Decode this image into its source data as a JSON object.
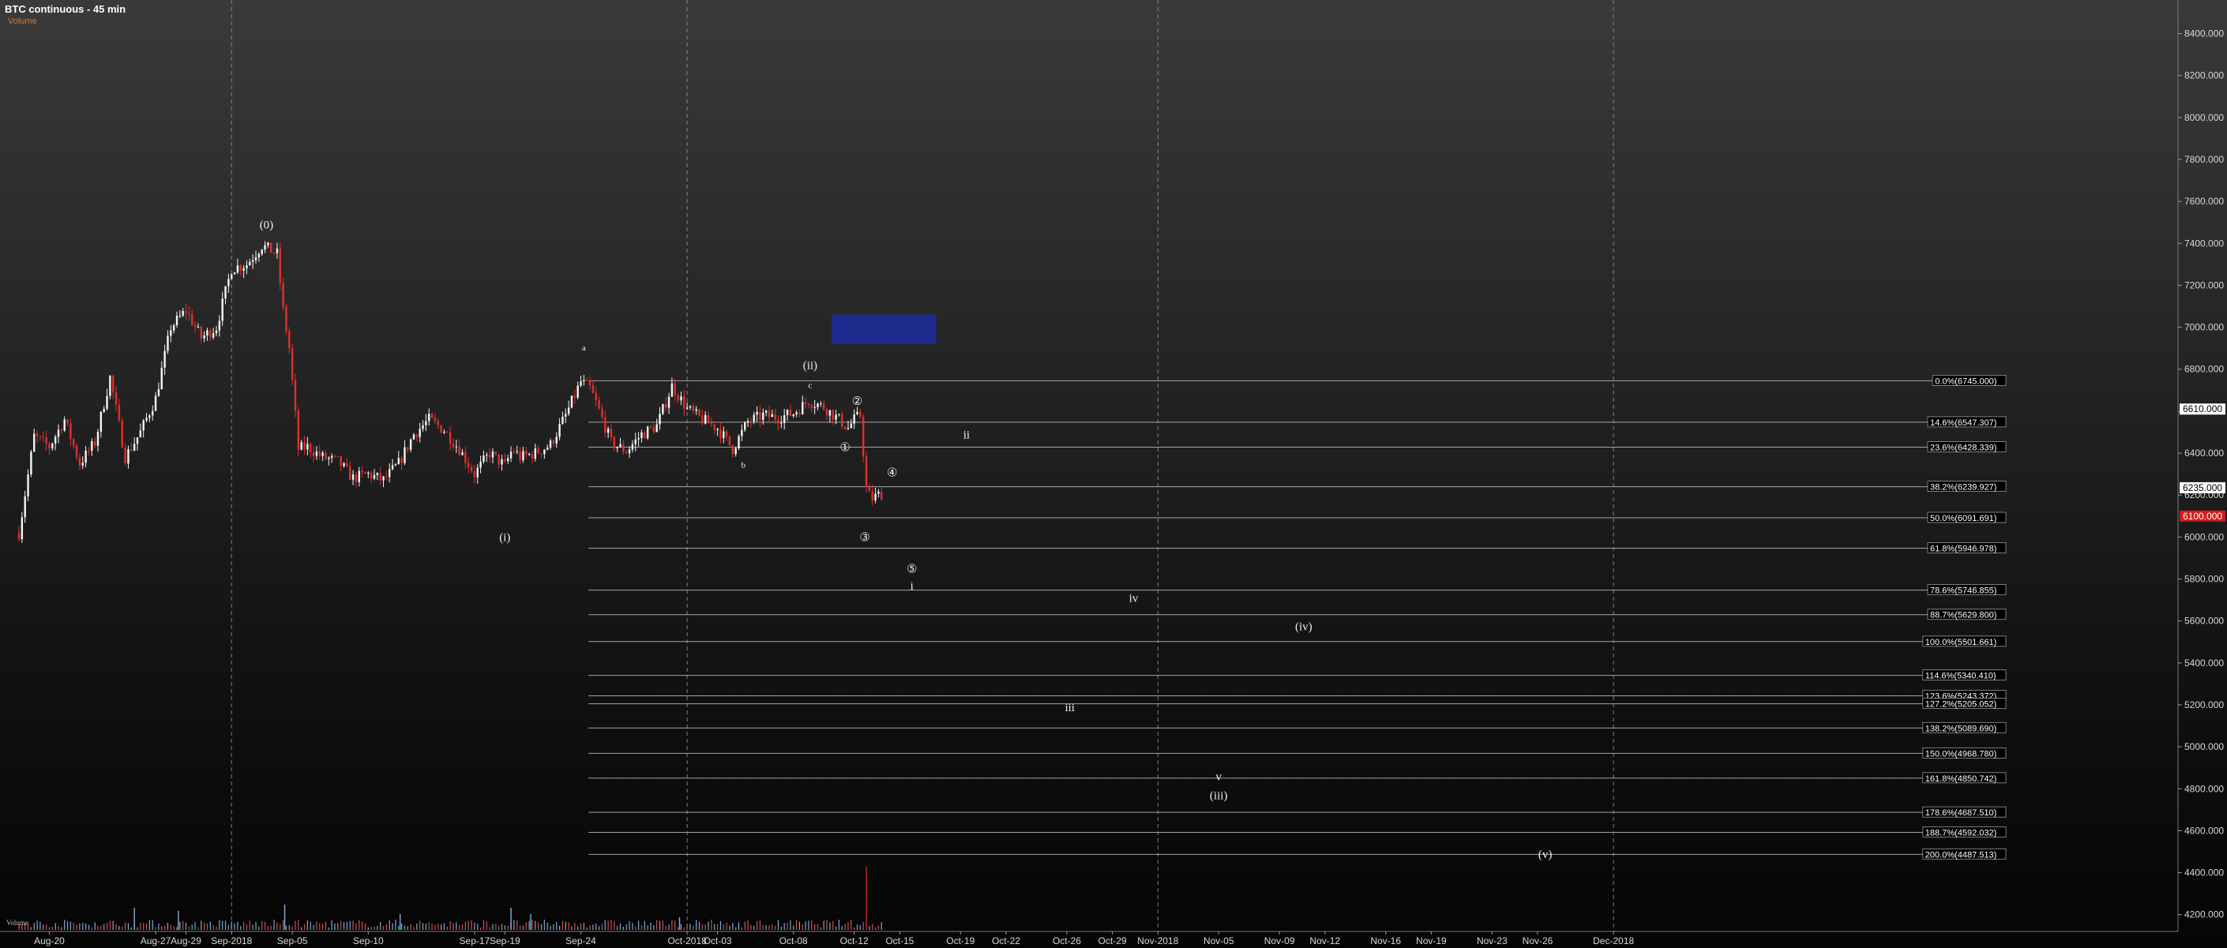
{
  "header": {
    "title": "BTC continuous - 45 min",
    "indicator": "Volume"
  },
  "colors": {
    "up_candle": "#f5f5f5",
    "down_candle": "#e03030",
    "fib_line": "#bdbdbd",
    "box_fill": "#1e2a8c",
    "last_price_marker": "#ffffff",
    "red_price_marker": "#d01c1c"
  },
  "chart_data": {
    "type": "candlestick",
    "title": "BTC continuous - 45 min",
    "y_ticks": [
      "8400.000",
      "8200.000",
      "8000.000",
      "7800.000",
      "7600.000",
      "7400.000",
      "7200.000",
      "7000.000",
      "6800.000",
      "6600.000",
      "6400.000",
      "6200.000",
      "6000.000",
      "5800.000",
      "5600.000",
      "5400.000",
      "5200.000",
      "5000.000",
      "4800.000",
      "4600.000",
      "4400.000",
      "4200.000"
    ],
    "ylim": [
      4120,
      8560
    ],
    "price_markers": [
      {
        "label": "6610.000",
        "value": 6610,
        "style": "white"
      },
      {
        "label": "6235.000",
        "value": 6235,
        "style": "white"
      },
      {
        "label": "6100.000",
        "value": 6100,
        "style": "red"
      }
    ],
    "x_ticks": [
      {
        "label": "Aug-20",
        "day": 2
      },
      {
        "label": "Aug-27",
        "day": 9
      },
      {
        "label": "Aug-29",
        "day": 11
      },
      {
        "label": "Sep-2018",
        "day": 14
      },
      {
        "label": "Sep-05",
        "day": 18
      },
      {
        "label": "Sep-10",
        "day": 23
      },
      {
        "label": "Sep-17",
        "day": 30
      },
      {
        "label": "Sep-19",
        "day": 32
      },
      {
        "label": "Sep-24",
        "day": 37
      },
      {
        "label": "Oct-2018",
        "day": 44
      },
      {
        "label": "Oct-03",
        "day": 46
      },
      {
        "label": "Oct-08",
        "day": 51
      },
      {
        "label": "Oct-12",
        "day": 55
      },
      {
        "label": "Oct-15",
        "day": 58
      },
      {
        "label": "Oct-19",
        "day": 62
      },
      {
        "label": "Oct-22",
        "day": 65
      },
      {
        "label": "Oct-26",
        "day": 69
      },
      {
        "label": "Oct-29",
        "day": 72
      },
      {
        "label": "Nov-2018",
        "day": 75
      },
      {
        "label": "Nov-05",
        "day": 79
      },
      {
        "label": "Nov-09",
        "day": 83
      },
      {
        "label": "Nov-12",
        "day": 86
      },
      {
        "label": "Nov-16",
        "day": 90
      },
      {
        "label": "Nov-19",
        "day": 93
      },
      {
        "label": "Nov-23",
        "day": 97
      },
      {
        "label": "Nov-26",
        "day": 100
      },
      {
        "label": "Dec-2018",
        "day": 105
      }
    ],
    "month_separators": [
      14,
      44,
      75,
      105
    ],
    "fib_levels": [
      {
        "label": "0.0%(6745.000)",
        "value": 6745.0
      },
      {
        "label": "14.6%(6547.307)",
        "value": 6547.307
      },
      {
        "label": "23.6%(6428.339)",
        "value": 6428.339
      },
      {
        "label": "38.2%(6239.927)",
        "value": 6239.927
      },
      {
        "label": "50.0%(6091.691)",
        "value": 6091.691
      },
      {
        "label": "61.8%(5946.978)",
        "value": 5946.978
      },
      {
        "label": "78.6%(5746.855)",
        "value": 5746.855
      },
      {
        "label": "88.7%(5629.800)",
        "value": 5629.8
      },
      {
        "label": "100.0%(5501.661)",
        "value": 5501.661
      },
      {
        "label": "114.6%(5340.410)",
        "value": 5340.41
      },
      {
        "label": "123.6%(5243.372)",
        "value": 5243.372
      },
      {
        "label": "127.2%(5205.052)",
        "value": 5205.052
      },
      {
        "label": "138.2%(5089.690)",
        "value": 5089.69
      },
      {
        "label": "150.0%(4968.780)",
        "value": 4968.78
      },
      {
        "label": "161.8%(4850.742)",
        "value": 4850.742
      },
      {
        "label": "178.6%(4687.510)",
        "value": 4687.51
      },
      {
        "label": "188.7%(4592.032)",
        "value": 4592.032
      },
      {
        "label": "200.0%(4487.513)",
        "value": 4487.513
      }
    ],
    "fib_start_day": 37.5,
    "price_path": [
      {
        "day": 0,
        "price": 6020
      },
      {
        "day": 1,
        "price": 6480
      },
      {
        "day": 2,
        "price": 6430
      },
      {
        "day": 3,
        "price": 6560
      },
      {
        "day": 4,
        "price": 6350
      },
      {
        "day": 5,
        "price": 6450
      },
      {
        "day": 6,
        "price": 6760
      },
      {
        "day": 7,
        "price": 6380
      },
      {
        "day": 8,
        "price": 6500
      },
      {
        "day": 9,
        "price": 6660
      },
      {
        "day": 10,
        "price": 7000
      },
      {
        "day": 11,
        "price": 7080
      },
      {
        "day": 12,
        "price": 6950
      },
      {
        "day": 13,
        "price": 7000
      },
      {
        "day": 14,
        "price": 7280
      },
      {
        "day": 15,
        "price": 7300
      },
      {
        "day": 16,
        "price": 7390
      },
      {
        "day": 17,
        "price": 7350
      },
      {
        "day": 17.4,
        "price": 7080
      },
      {
        "day": 17.8,
        "price": 6900
      },
      {
        "day": 18.4,
        "price": 6420
      },
      {
        "day": 19,
        "price": 6430
      },
      {
        "day": 20,
        "price": 6380
      },
      {
        "day": 21,
        "price": 6360
      },
      {
        "day": 22,
        "price": 6280
      },
      {
        "day": 23,
        "price": 6300
      },
      {
        "day": 24,
        "price": 6270
      },
      {
        "day": 25,
        "price": 6350
      },
      {
        "day": 26,
        "price": 6490
      },
      {
        "day": 27,
        "price": 6560
      },
      {
        "day": 28,
        "price": 6510
      },
      {
        "day": 29,
        "price": 6420
      },
      {
        "day": 30,
        "price": 6300
      },
      {
        "day": 31,
        "price": 6400
      },
      {
        "day": 32,
        "price": 6340
      },
      {
        "day": 32.5,
        "price": 6420
      },
      {
        "day": 33,
        "price": 6380
      },
      {
        "day": 34,
        "price": 6400
      },
      {
        "day": 35,
        "price": 6440
      },
      {
        "day": 36,
        "price": 6580
      },
      {
        "day": 37,
        "price": 6740
      },
      {
        "day": 37.6,
        "price": 6710
      },
      {
        "day": 38,
        "price": 6640
      },
      {
        "day": 39,
        "price": 6450
      },
      {
        "day": 40,
        "price": 6410
      },
      {
        "day": 41,
        "price": 6490
      },
      {
        "day": 42,
        "price": 6530
      },
      {
        "day": 43,
        "price": 6720
      },
      {
        "day": 44,
        "price": 6610
      },
      {
        "day": 45,
        "price": 6560
      },
      {
        "day": 46,
        "price": 6520
      },
      {
        "day": 47,
        "price": 6420
      },
      {
        "day": 48,
        "price": 6550
      },
      {
        "day": 49,
        "price": 6580
      },
      {
        "day": 50,
        "price": 6570
      },
      {
        "day": 51,
        "price": 6590
      },
      {
        "day": 52,
        "price": 6650
      },
      {
        "day": 53,
        "price": 6620
      },
      {
        "day": 54,
        "price": 6560
      },
      {
        "day": 54.6,
        "price": 6520
      },
      {
        "day": 55,
        "price": 6560
      },
      {
        "day": 55.4,
        "price": 6580
      },
      {
        "day": 55.8,
        "price": 6230
      },
      {
        "day": 56.1,
        "price": 6180
      },
      {
        "day": 56.6,
        "price": 6200
      },
      {
        "day": 57,
        "price": 6210
      }
    ],
    "volume_spikes": [
      {
        "day": 7.6,
        "value": 0.35
      },
      {
        "day": 10.5,
        "value": 0.3
      },
      {
        "day": 17.5,
        "value": 0.4
      },
      {
        "day": 25.1,
        "value": 0.25
      },
      {
        "day": 32.4,
        "value": 0.35
      },
      {
        "day": 33.7,
        "value": 0.25
      },
      {
        "day": 43.5,
        "value": 0.2
      },
      {
        "day": 55.8,
        "value": 1.0
      }
    ],
    "volume_caption": "Volume",
    "annotations": [
      {
        "text": "(0)",
        "day": 16.3,
        "price": 7470,
        "size": "lg"
      },
      {
        "text": "(i)",
        "day": 32.0,
        "price": 5980,
        "size": "lg"
      },
      {
        "text": "a",
        "day": 37.2,
        "price": 6890,
        "size": "sm"
      },
      {
        "text": "b",
        "day": 47.7,
        "price": 6330,
        "size": "sm"
      },
      {
        "text": "c",
        "day": 52.1,
        "price": 6710,
        "size": "sm"
      },
      {
        "text": "(ii)",
        "day": 52.1,
        "price": 6800,
        "size": "lg"
      },
      {
        "text": "②",
        "day": 55.2,
        "price": 6630,
        "size": "lg"
      },
      {
        "text": "①",
        "day": 54.4,
        "price": 6410,
        "size": "lg"
      },
      {
        "text": "④",
        "day": 57.5,
        "price": 6290,
        "size": "lg"
      },
      {
        "text": "③",
        "day": 55.7,
        "price": 5980,
        "size": "lg"
      },
      {
        "text": "⑤",
        "day": 58.8,
        "price": 5830,
        "size": "lg"
      },
      {
        "text": "i",
        "day": 58.8,
        "price": 5750,
        "size": "lg"
      },
      {
        "text": "ii",
        "day": 62.4,
        "price": 6470,
        "size": "lg"
      },
      {
        "text": "iv",
        "day": 73.4,
        "price": 5690,
        "size": "lg"
      },
      {
        "text": "(iv)",
        "day": 84.6,
        "price": 5555,
        "size": "lg"
      },
      {
        "text": "iii",
        "day": 69.2,
        "price": 5170,
        "size": "lg"
      },
      {
        "text": "v",
        "day": 79.0,
        "price": 4840,
        "size": "lg"
      },
      {
        "text": "(iii)",
        "day": 79.0,
        "price": 4750,
        "size": "lg"
      },
      {
        "text": "(v)",
        "day": 100.5,
        "price": 4470,
        "size": "lg"
      }
    ],
    "target_box": {
      "day_start": 53.5,
      "day_end": 60.4,
      "price_top": 7060,
      "price_bottom": 6920
    },
    "legend": "none",
    "grid": "month separators only"
  }
}
